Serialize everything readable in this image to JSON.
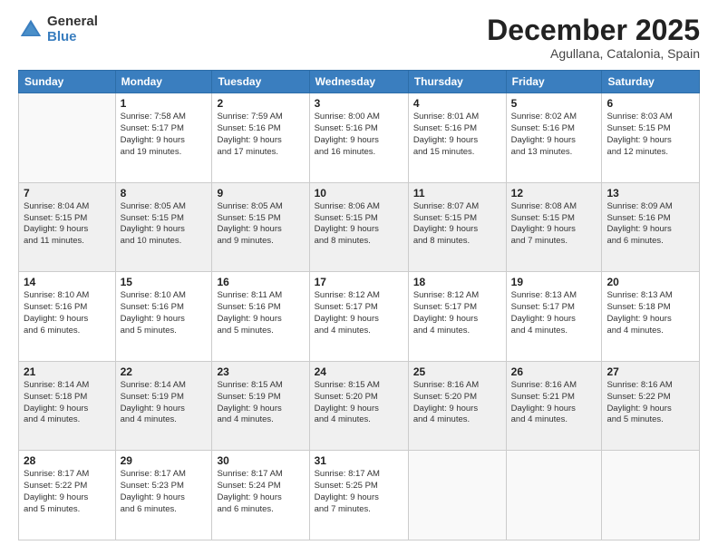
{
  "logo": {
    "general": "General",
    "blue": "Blue"
  },
  "header": {
    "month": "December 2025",
    "location": "Agullana, Catalonia, Spain"
  },
  "weekdays": [
    "Sunday",
    "Monday",
    "Tuesday",
    "Wednesday",
    "Thursday",
    "Friday",
    "Saturday"
  ],
  "weeks": [
    [
      {
        "day": "",
        "info": ""
      },
      {
        "day": "1",
        "info": "Sunrise: 7:58 AM\nSunset: 5:17 PM\nDaylight: 9 hours\nand 19 minutes."
      },
      {
        "day": "2",
        "info": "Sunrise: 7:59 AM\nSunset: 5:16 PM\nDaylight: 9 hours\nand 17 minutes."
      },
      {
        "day": "3",
        "info": "Sunrise: 8:00 AM\nSunset: 5:16 PM\nDaylight: 9 hours\nand 16 minutes."
      },
      {
        "day": "4",
        "info": "Sunrise: 8:01 AM\nSunset: 5:16 PM\nDaylight: 9 hours\nand 15 minutes."
      },
      {
        "day": "5",
        "info": "Sunrise: 8:02 AM\nSunset: 5:16 PM\nDaylight: 9 hours\nand 13 minutes."
      },
      {
        "day": "6",
        "info": "Sunrise: 8:03 AM\nSunset: 5:15 PM\nDaylight: 9 hours\nand 12 minutes."
      }
    ],
    [
      {
        "day": "7",
        "info": "Sunrise: 8:04 AM\nSunset: 5:15 PM\nDaylight: 9 hours\nand 11 minutes."
      },
      {
        "day": "8",
        "info": "Sunrise: 8:05 AM\nSunset: 5:15 PM\nDaylight: 9 hours\nand 10 minutes."
      },
      {
        "day": "9",
        "info": "Sunrise: 8:05 AM\nSunset: 5:15 PM\nDaylight: 9 hours\nand 9 minutes."
      },
      {
        "day": "10",
        "info": "Sunrise: 8:06 AM\nSunset: 5:15 PM\nDaylight: 9 hours\nand 8 minutes."
      },
      {
        "day": "11",
        "info": "Sunrise: 8:07 AM\nSunset: 5:15 PM\nDaylight: 9 hours\nand 8 minutes."
      },
      {
        "day": "12",
        "info": "Sunrise: 8:08 AM\nSunset: 5:15 PM\nDaylight: 9 hours\nand 7 minutes."
      },
      {
        "day": "13",
        "info": "Sunrise: 8:09 AM\nSunset: 5:16 PM\nDaylight: 9 hours\nand 6 minutes."
      }
    ],
    [
      {
        "day": "14",
        "info": "Sunrise: 8:10 AM\nSunset: 5:16 PM\nDaylight: 9 hours\nand 6 minutes."
      },
      {
        "day": "15",
        "info": "Sunrise: 8:10 AM\nSunset: 5:16 PM\nDaylight: 9 hours\nand 5 minutes."
      },
      {
        "day": "16",
        "info": "Sunrise: 8:11 AM\nSunset: 5:16 PM\nDaylight: 9 hours\nand 5 minutes."
      },
      {
        "day": "17",
        "info": "Sunrise: 8:12 AM\nSunset: 5:17 PM\nDaylight: 9 hours\nand 4 minutes."
      },
      {
        "day": "18",
        "info": "Sunrise: 8:12 AM\nSunset: 5:17 PM\nDaylight: 9 hours\nand 4 minutes."
      },
      {
        "day": "19",
        "info": "Sunrise: 8:13 AM\nSunset: 5:17 PM\nDaylight: 9 hours\nand 4 minutes."
      },
      {
        "day": "20",
        "info": "Sunrise: 8:13 AM\nSunset: 5:18 PM\nDaylight: 9 hours\nand 4 minutes."
      }
    ],
    [
      {
        "day": "21",
        "info": "Sunrise: 8:14 AM\nSunset: 5:18 PM\nDaylight: 9 hours\nand 4 minutes."
      },
      {
        "day": "22",
        "info": "Sunrise: 8:14 AM\nSunset: 5:19 PM\nDaylight: 9 hours\nand 4 minutes."
      },
      {
        "day": "23",
        "info": "Sunrise: 8:15 AM\nSunset: 5:19 PM\nDaylight: 9 hours\nand 4 minutes."
      },
      {
        "day": "24",
        "info": "Sunrise: 8:15 AM\nSunset: 5:20 PM\nDaylight: 9 hours\nand 4 minutes."
      },
      {
        "day": "25",
        "info": "Sunrise: 8:16 AM\nSunset: 5:20 PM\nDaylight: 9 hours\nand 4 minutes."
      },
      {
        "day": "26",
        "info": "Sunrise: 8:16 AM\nSunset: 5:21 PM\nDaylight: 9 hours\nand 4 minutes."
      },
      {
        "day": "27",
        "info": "Sunrise: 8:16 AM\nSunset: 5:22 PM\nDaylight: 9 hours\nand 5 minutes."
      }
    ],
    [
      {
        "day": "28",
        "info": "Sunrise: 8:17 AM\nSunset: 5:22 PM\nDaylight: 9 hours\nand 5 minutes."
      },
      {
        "day": "29",
        "info": "Sunrise: 8:17 AM\nSunset: 5:23 PM\nDaylight: 9 hours\nand 6 minutes."
      },
      {
        "day": "30",
        "info": "Sunrise: 8:17 AM\nSunset: 5:24 PM\nDaylight: 9 hours\nand 6 minutes."
      },
      {
        "day": "31",
        "info": "Sunrise: 8:17 AM\nSunset: 5:25 PM\nDaylight: 9 hours\nand 7 minutes."
      },
      {
        "day": "",
        "info": ""
      },
      {
        "day": "",
        "info": ""
      },
      {
        "day": "",
        "info": ""
      }
    ]
  ]
}
